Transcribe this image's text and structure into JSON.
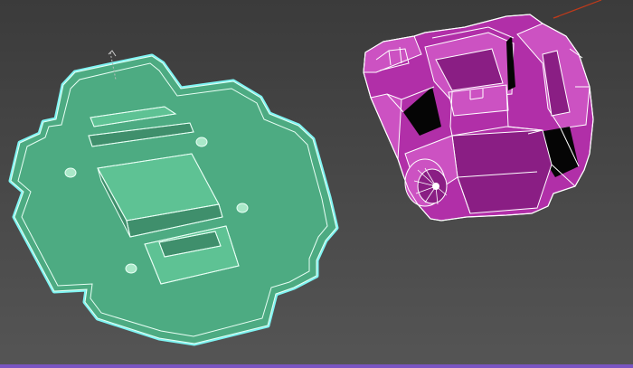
{
  "viewport": {
    "background_top": "#3b3b3b",
    "background_bottom": "#555555"
  },
  "objects": [
    {
      "name": "green-plate",
      "fill": "#4dab82",
      "face_light": "#5ec294",
      "face_dark": "#3f8f6c",
      "selection_outline": "#7ff4f2",
      "edges": "#e8fff5"
    },
    {
      "name": "magenta-housing",
      "fill": "#b12fa8",
      "face_light": "#cc52c2",
      "face_dark": "#8a1e84",
      "edges": "#ffffff",
      "selection_outline": "#ffffff"
    }
  ],
  "gizmo": {
    "color": "#c03a1a"
  },
  "bottom_strip_color": "#7a55c2"
}
